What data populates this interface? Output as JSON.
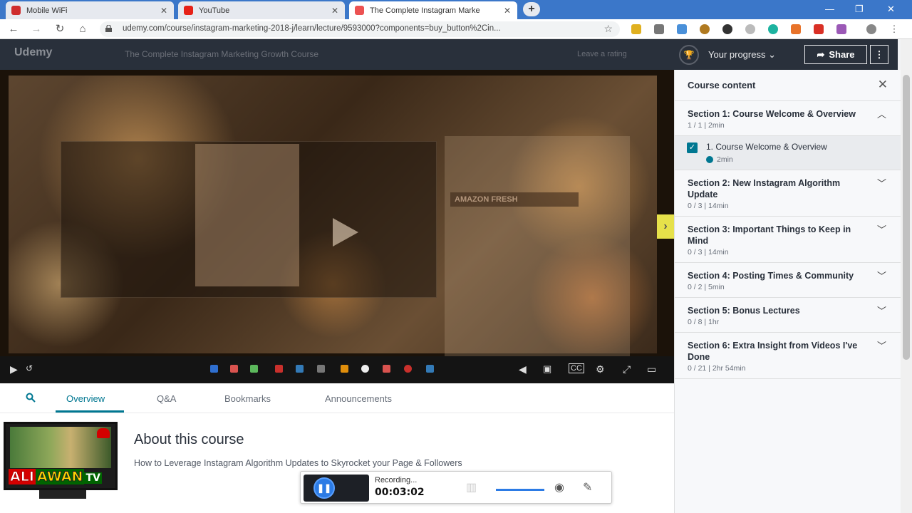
{
  "browser": {
    "tabs": [
      {
        "title": "Mobile WiFi",
        "icon": "huawei-icon",
        "color": "#cf2d2d"
      },
      {
        "title": "YouTube",
        "icon": "youtube-icon",
        "color": "#e62117"
      },
      {
        "title": "The Complete Instagram Marke",
        "icon": "udemy-icon",
        "color": "#ec5252"
      }
    ],
    "new_tab": "+",
    "url": "udemy.com/course/instagram-marketing-2018-j/learn/lecture/9593000?components=buy_button%2Cin..."
  },
  "header": {
    "logo": "Udemy",
    "course_title": "The Complete Instagram Marketing Growth Course",
    "leave_rating": "Leave a rating",
    "your_progress": "Your progress",
    "share": "Share",
    "more": "⋮"
  },
  "player": {
    "inner_label": "AMAZON FRESH"
  },
  "sidebar": {
    "title": "Course content",
    "sections": [
      {
        "title": "Section 1: Course Welcome & Overview",
        "meta": "1 / 1 | 2min",
        "expanded": true
      },
      {
        "title": "Section 2: New Instagram Algorithm Update",
        "meta": "0 / 3 | 14min"
      },
      {
        "title": "Section 3: Important Things to Keep in Mind",
        "meta": "0 / 3 | 14min"
      },
      {
        "title": "Section 4: Posting Times & Community",
        "meta": "0 / 2 | 5min"
      },
      {
        "title": "Section 5: Bonus Lectures",
        "meta": "0 / 8 | 1hr"
      },
      {
        "title": "Section 6: Extra Insight from Videos I've Done",
        "meta": "0 / 21 | 2hr 54min"
      }
    ],
    "lecture": {
      "title": "1. Course Welcome & Overview",
      "meta": "2min"
    }
  },
  "content_tabs": [
    "Overview",
    "Q&A",
    "Bookmarks",
    "Announcements"
  ],
  "about": {
    "title": "About this course",
    "description": "How to Leverage Instagram Algorithm Updates to Skyrocket your Page & Followers"
  },
  "watermark": {
    "ali": "ALI",
    "awan": "AWAN",
    "tv": "TV"
  },
  "recorder": {
    "status": "Recording...",
    "time": "00:03:02"
  },
  "colors": {
    "accent": "#007791",
    "header_bg": "#29303b",
    "chrome_blue": "#3b77c9"
  }
}
